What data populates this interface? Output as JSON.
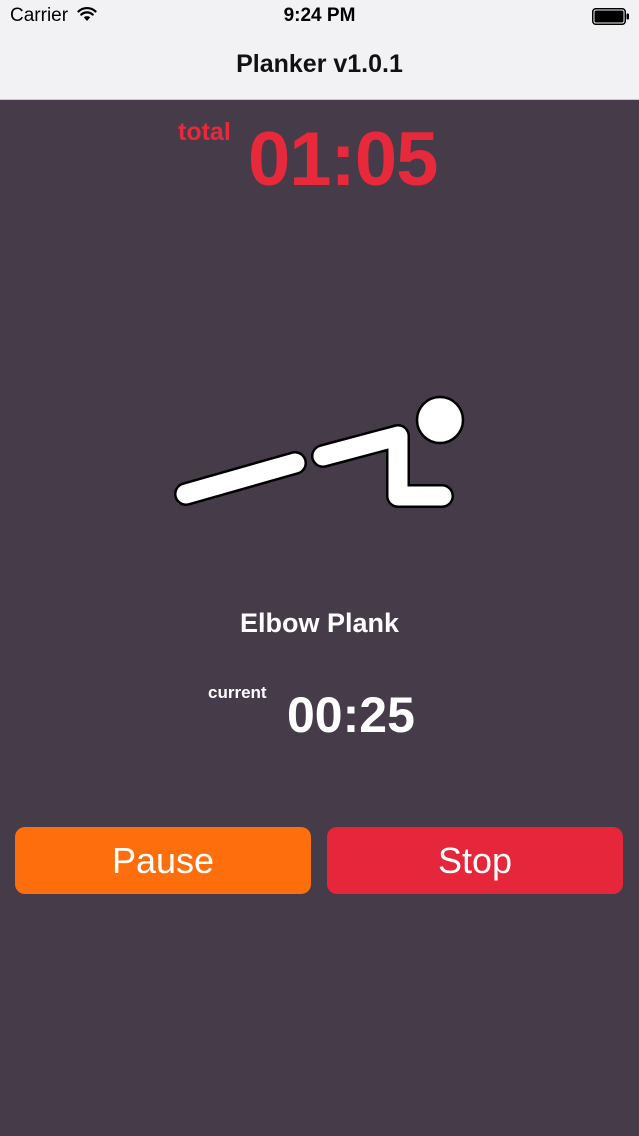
{
  "status_bar": {
    "carrier": "Carrier",
    "time": "9:24 PM",
    "icons": [
      "wifi-icon",
      "battery-icon"
    ]
  },
  "nav": {
    "title": "Planker v1.0.1"
  },
  "timer": {
    "total_label": "total",
    "total_time": "01:05",
    "current_label": "current",
    "current_time": "00:25"
  },
  "exercise": {
    "name": "Elbow Plank",
    "icon": "elbow-plank-icon"
  },
  "buttons": {
    "pause_label": "Pause",
    "stop_label": "Stop"
  },
  "colors": {
    "background": "#463c49",
    "bar": "#f2f2f5",
    "total_accent": "#e8293b",
    "pause": "#ff6e0c",
    "stop": "#e6263a",
    "text": "#ffffff"
  }
}
